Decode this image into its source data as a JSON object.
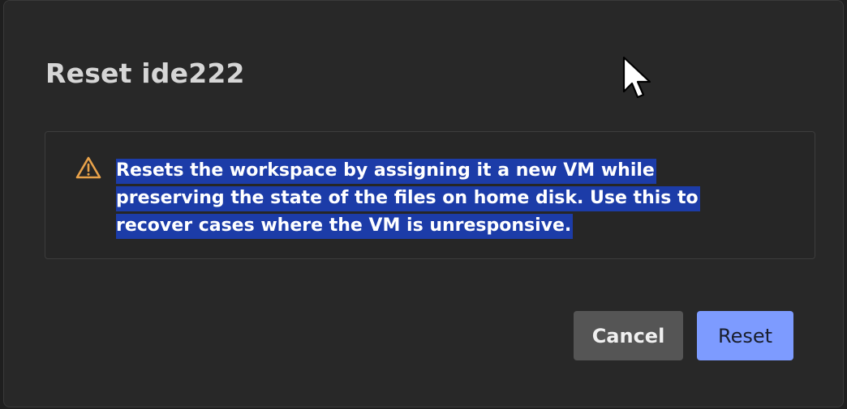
{
  "dialog": {
    "title": "Reset ide222",
    "warning": {
      "icon": "warning-triangle-icon",
      "icon_color": "#e8a24a",
      "text": "Resets the workspace by assigning it a new VM while preserving the state of the files on home disk. Use this to recover cases where the VM is unresponsive.",
      "selection_color": "#1c3ca8"
    },
    "buttons": {
      "cancel_label": "Cancel",
      "reset_label": "Reset",
      "reset_color": "#7d9bff"
    }
  },
  "cursor": {
    "icon": "mouse-pointer-icon"
  }
}
